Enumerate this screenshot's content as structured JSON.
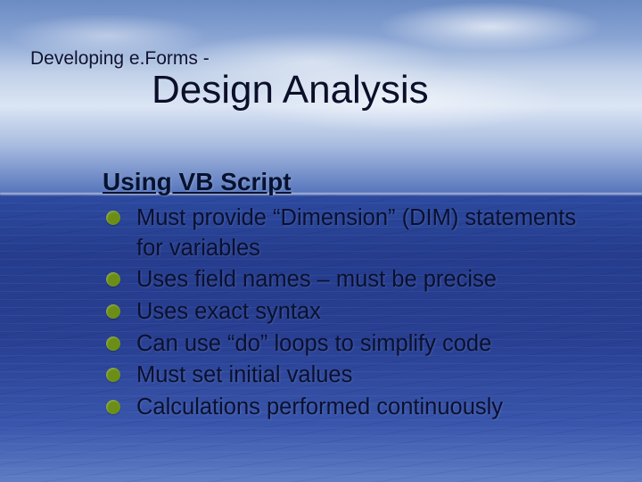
{
  "pretitle": "Developing e.Forms -",
  "title": "Design Analysis",
  "subheading": "Using VB Script",
  "bullets": [
    "Must provide “Dimension” (DIM) statements for variables",
    "Uses field names – must be precise",
    "Uses exact syntax",
    "Can use “do” loops to simplify code",
    "Must set initial values",
    "Calculations performed continuously"
  ]
}
